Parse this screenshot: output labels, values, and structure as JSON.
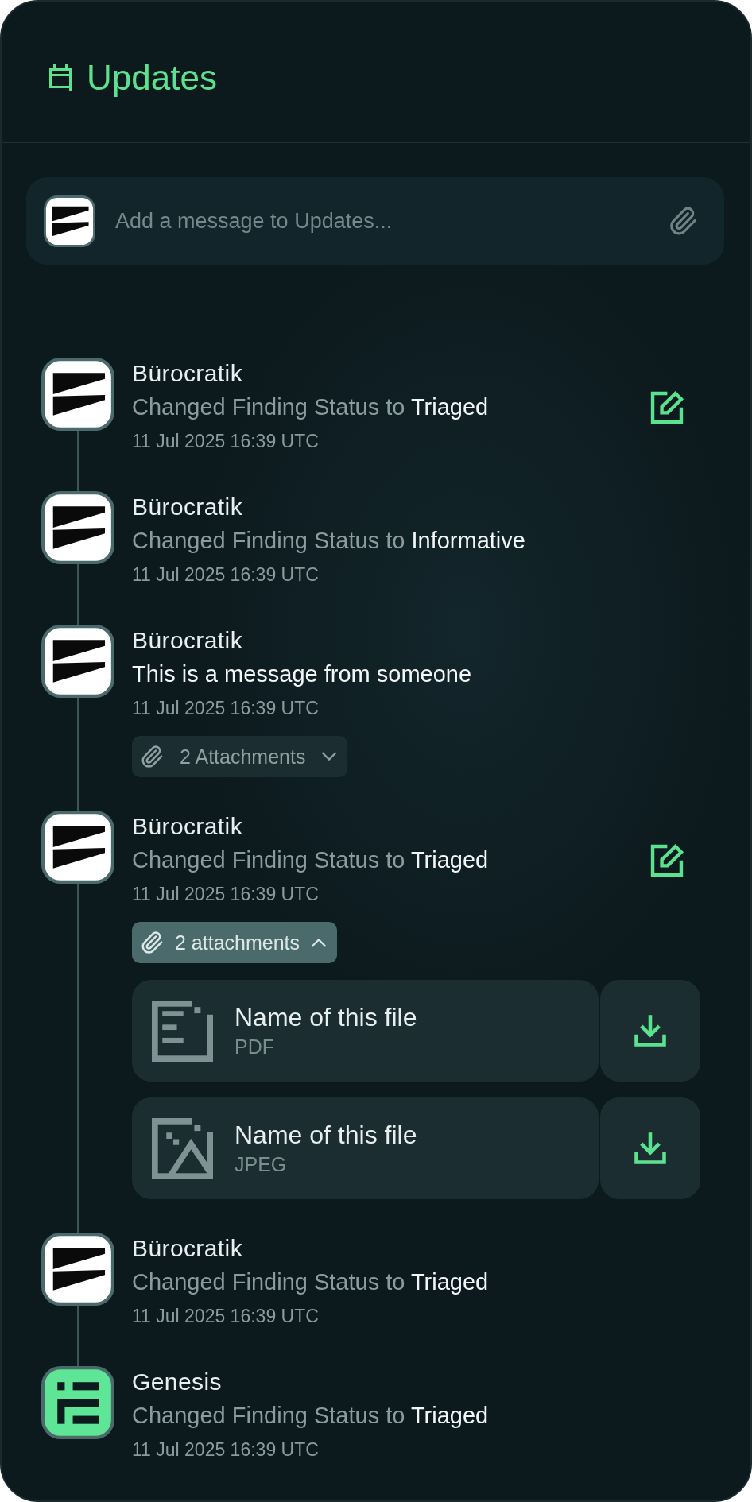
{
  "header": {
    "title": "Updates"
  },
  "composer": {
    "avatar": {
      "kind": "wedge"
    },
    "placeholder": "Add a message to Updates..."
  },
  "entries": [
    {
      "author": "Bürocratik",
      "avatar": {
        "kind": "wedge"
      },
      "kind": "status",
      "action": "Changed Finding Status to",
      "status": "Triaged",
      "time": "11 Jul 2025 16:39 UTC",
      "editable": true
    },
    {
      "author": "Bürocratik",
      "avatar": {
        "kind": "wedge"
      },
      "kind": "status",
      "action": "Changed Finding Status to",
      "status": "Informative",
      "time": "11 Jul 2025 16:39 UTC",
      "editable": false
    },
    {
      "author": "Bürocratik",
      "avatar": {
        "kind": "wedge"
      },
      "kind": "message",
      "message": "This is a message from someone",
      "time": "11 Jul 2025 16:39 UTC",
      "editable": false,
      "attachments": {
        "label": "2 Attachments",
        "expanded": false
      }
    },
    {
      "author": "Bürocratik",
      "avatar": {
        "kind": "wedge"
      },
      "kind": "status",
      "action": "Changed Finding Status to",
      "status": "Triaged",
      "time": "11 Jul 2025 16:39 UTC",
      "editable": true,
      "attachments": {
        "label": "2 attachments",
        "expanded": true,
        "files": [
          {
            "name": "Name of this file",
            "type": "PDF",
            "kind": "document"
          },
          {
            "name": "Name of this file",
            "type": "JPEG",
            "kind": "image"
          }
        ]
      }
    },
    {
      "author": "Bürocratik",
      "avatar": {
        "kind": "wedge"
      },
      "kind": "status",
      "action": "Changed Finding Status to",
      "status": "Triaged",
      "time": "11 Jul 2025 16:39 UTC",
      "editable": false
    },
    {
      "author": "Genesis",
      "avatar": {
        "kind": "blocks"
      },
      "kind": "status",
      "action": "Changed Finding Status to",
      "status": "Triaged",
      "time": "11 Jul 2025 16:39 UTC",
      "editable": false
    }
  ]
}
